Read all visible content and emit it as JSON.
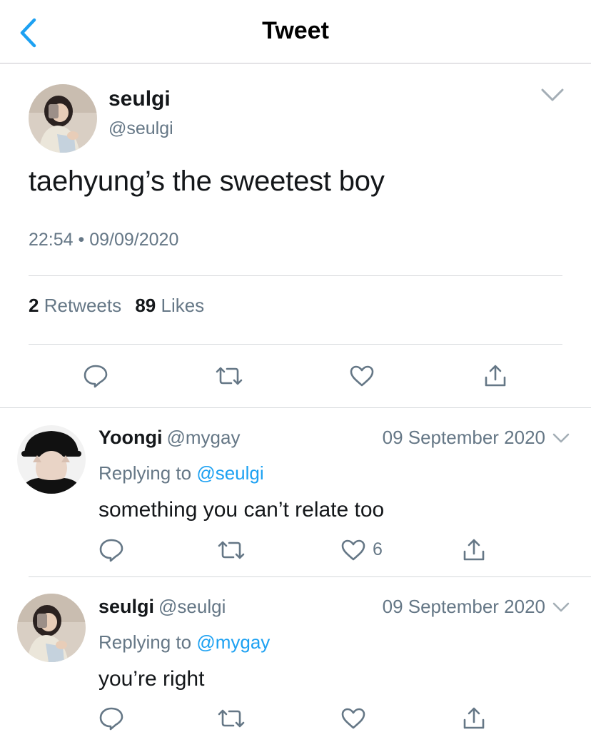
{
  "nav": {
    "title": "Tweet"
  },
  "main_tweet": {
    "name": "seulgi",
    "handle": "@seulgi",
    "text": "taehyung’s the sweetest boy",
    "time": "22:54",
    "separator": "•",
    "date": "09/09/2020",
    "retweets_count": "2",
    "retweets_label": "Retweets",
    "likes_count": "89",
    "likes_label": "Likes"
  },
  "replies": [
    {
      "name": "Yoongi",
      "handle": "@mygay",
      "date": "09 September 2020",
      "replying_label": "Replying to",
      "replying_to": "@seulgi",
      "text": "something you can’t relate too",
      "likes": "6"
    },
    {
      "name": "seulgi",
      "handle": "@seulgi",
      "date": "09 September 2020",
      "replying_label": "Replying to",
      "replying_to": "@mygay",
      "text": "you’re right",
      "likes": ""
    }
  ],
  "colors": {
    "accent": "#1da1f2",
    "secondary_text": "#657786",
    "primary_text": "#14171a",
    "divider": "#d6d9dc",
    "icon": "#657786"
  },
  "icons": {
    "back": "chevron-left-icon",
    "caret": "chevron-down-icon",
    "reply": "comment-bubble-icon",
    "retweet": "retweet-icon",
    "like": "heart-icon",
    "share": "share-icon"
  }
}
